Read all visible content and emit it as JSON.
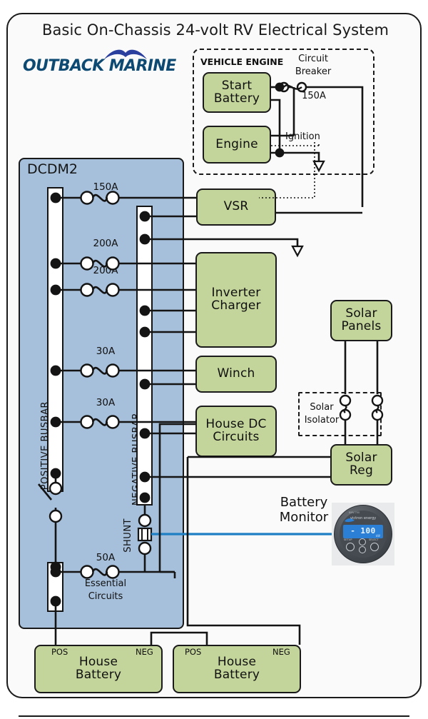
{
  "page": {
    "title": "Basic On-Chassis 24-volt RV Electrical System",
    "logo_text": "OUTBACK MARINE",
    "colors": {
      "panel_blue": "#a6bfda",
      "box_green": "#c3d59a",
      "wire_black": "#141414",
      "monitor_cable_blue": "#1f7fc4",
      "logo_navy": "#0d4a73"
    }
  },
  "vehicle_engine": {
    "title": "VEHICLE ENGINE",
    "breaker_caption_line1": "Circuit",
    "breaker_caption_line2": "Breaker",
    "breaker_rating": "150A",
    "ignition_label": "Ignition",
    "boxes": [
      {
        "line1": "Start",
        "line2": "Battery"
      },
      {
        "line1": "Engine",
        "line2": ""
      }
    ]
  },
  "dcdm2": {
    "label": "DCDM2",
    "positive_busbar_label": "POSITIVE BUSBAR",
    "negative_busbar_label": "NEGATIVE BUSBAR",
    "shunt_label": "SHUNT",
    "breakers": [
      {
        "rating": "150A",
        "caption": ""
      },
      {
        "rating": "200A",
        "caption": ""
      },
      {
        "rating": "200A",
        "caption": ""
      },
      {
        "rating": "30A",
        "caption": ""
      },
      {
        "rating": "30A",
        "caption": ""
      },
      {
        "rating": "50A",
        "caption_line1": "Essential",
        "caption_line2": "Circuits"
      }
    ]
  },
  "loads": [
    {
      "id": "vsr",
      "line1": "VSR",
      "line2": ""
    },
    {
      "id": "inverter-charger",
      "line1": "Inverter",
      "line2": "Charger"
    },
    {
      "id": "winch",
      "line1": "Winch",
      "line2": ""
    },
    {
      "id": "house-dc-circuits",
      "line1": "House DC",
      "line2": "Circuits"
    }
  ],
  "solar": {
    "panels_line1": "Solar",
    "panels_line2": "Panels",
    "isolator_line1": "Solar",
    "isolator_line2": "Isolator",
    "regulator_line1": "Solar",
    "regulator_line2": "Reg"
  },
  "battery_monitor": {
    "label_line1": "Battery",
    "label_line2": "Monitor",
    "device_brand": "victron energy",
    "device_tiny": "BMV-700",
    "display_value": "- 100",
    "display_unit": "kW",
    "display_sub": "Amps",
    "button_left": "SETUP",
    "button_right": "SELECT"
  },
  "house_batteries": [
    {
      "pos_label": "POS",
      "neg_label": "NEG",
      "line1": "House",
      "line2": "Battery"
    },
    {
      "pos_label": "POS",
      "neg_label": "NEG",
      "line1": "House",
      "line2": "Battery"
    }
  ]
}
